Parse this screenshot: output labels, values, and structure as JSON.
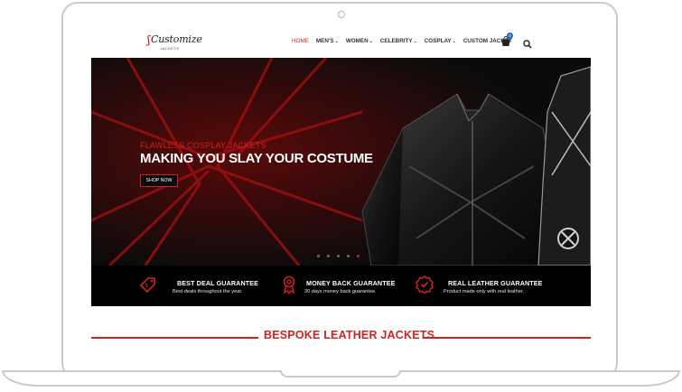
{
  "brand": {
    "logo_script": "Customize",
    "logo_sub": "JACKETS",
    "logo_alt": "Customize Jackets logo"
  },
  "nav": {
    "items": [
      {
        "label": "HOME",
        "active": true,
        "dropdown": false
      },
      {
        "label": "MEN'S",
        "active": false,
        "dropdown": true
      },
      {
        "label": "WOMEN",
        "active": false,
        "dropdown": true
      },
      {
        "label": "CELEBRITY",
        "active": false,
        "dropdown": true
      },
      {
        "label": "COSPLAY",
        "active": false,
        "dropdown": true
      },
      {
        "label": "CUSTOM JACKET",
        "active": false,
        "dropdown": false
      }
    ],
    "cart_count": "0",
    "icons": {
      "cart": "shopping-bag-icon",
      "search": "search-icon"
    }
  },
  "hero": {
    "subtitle": "FLAWLESS COSPLAY JACKETS",
    "title": "MAKING YOU SLAY YOUR COSTUME",
    "button": "SHOP NOW",
    "slides": 5,
    "active_slide": 5
  },
  "features": [
    {
      "icon": "price-tag-icon",
      "title": "BEST DEAL GUARANTEE",
      "desc": "Best deals throughout the year."
    },
    {
      "icon": "award-ribbon-icon",
      "title": "MONEY BACK GUARANTEE",
      "desc": "30 days money back guarantee."
    },
    {
      "icon": "quality-badge-icon",
      "title": "REAL LEATHER GUARANTEE",
      "desc": "Product made only with real leather."
    }
  ],
  "section": {
    "title": "BESPOKE LEATHER JACKETS"
  },
  "colors": {
    "accent": "#d32020",
    "hero_bg": "#0b0b0b",
    "frame": "#c9c9c9",
    "cart_badge": "#2a66d9"
  }
}
